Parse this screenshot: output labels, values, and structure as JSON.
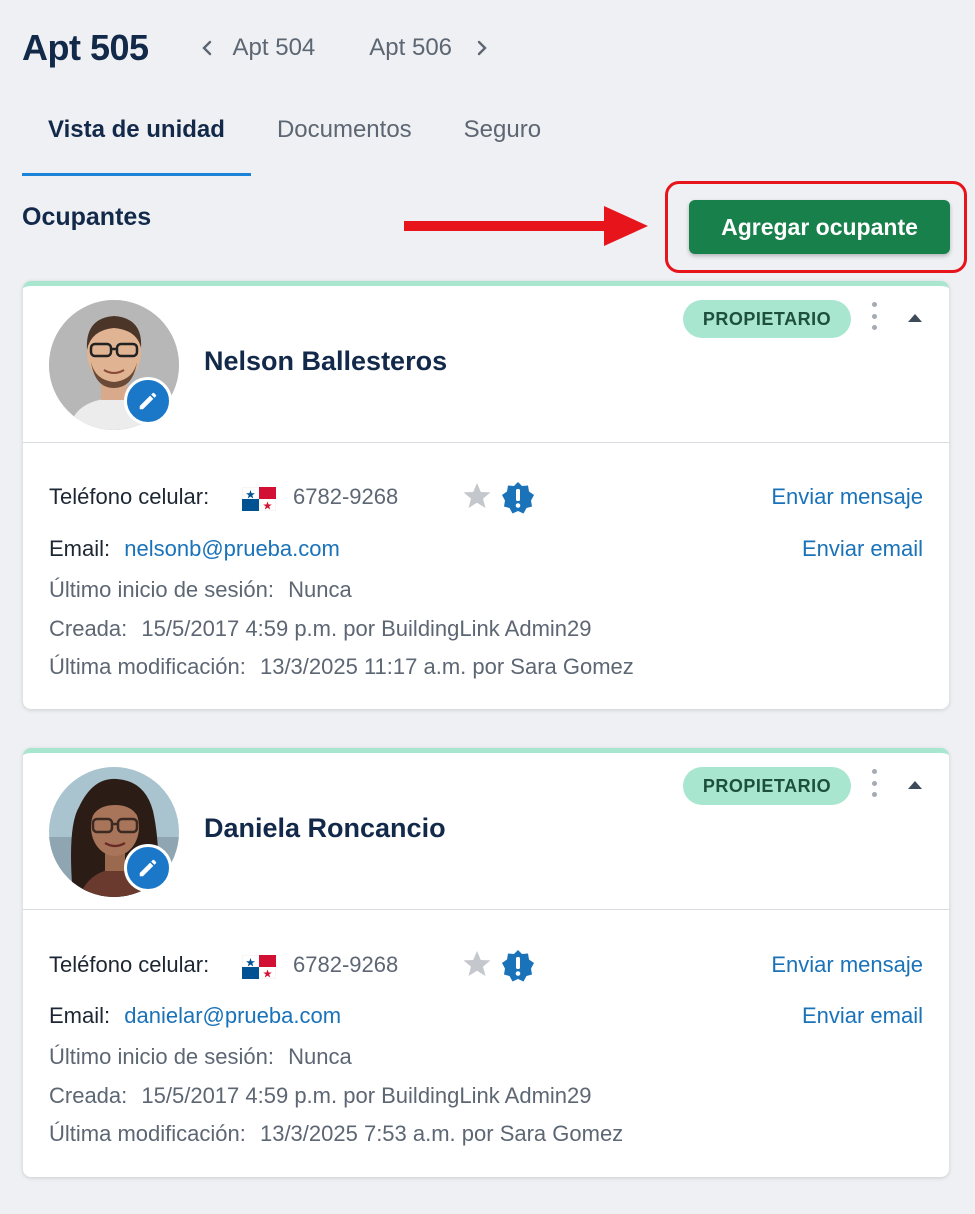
{
  "header": {
    "unit_title": "Apt 505",
    "prev_unit": "Apt 504",
    "next_unit": "Apt 506"
  },
  "tabs": [
    {
      "label": "Vista de unidad",
      "active": true
    },
    {
      "label": "Documentos",
      "active": false
    },
    {
      "label": "Seguro",
      "active": false
    }
  ],
  "section": {
    "title": "Ocupantes",
    "add_button_label": "Agregar ocupante"
  },
  "labels": {
    "phone": "Teléfono celular:",
    "email": "Email:",
    "last_login": "Último inicio de sesión:",
    "created": "Creada:",
    "modified": "Última modificación:",
    "send_message": "Enviar mensaje",
    "send_email": "Enviar email"
  },
  "occupants": [
    {
      "name": "Nelson Ballesteros",
      "role": "PROPIETARIO",
      "phone": "6782-9268",
      "email": "nelsonb@prueba.com",
      "last_login": "Nunca",
      "created": "15/5/2017 4:59 p.m. por BuildingLink Admin29",
      "modified": "13/3/2025 11:17 a.m. por Sara Gomez"
    },
    {
      "name": "Daniela Roncancio",
      "role": "PROPIETARIO",
      "phone": "6782-9268",
      "email": "danielar@prueba.com",
      "last_login": "Nunca",
      "created": "15/5/2017 4:59 p.m. por BuildingLink Admin29",
      "modified": "13/3/2025 7:53 a.m. por Sara Gomez"
    }
  ],
  "colors": {
    "primary_button": "#18804b",
    "role_badge": "#a8e6cf",
    "link": "#1a72b9",
    "highlight": "#e8141c",
    "tab_underline": "#1b84d8"
  },
  "icons": {
    "prev": "chevron-left-icon",
    "next": "chevron-right-icon",
    "edit": "pencil-icon",
    "menu": "kebab-menu-icon",
    "collapse": "caret-up-icon",
    "flag": "panama-flag-icon",
    "favorite": "star-icon",
    "alert": "alert-badge-icon"
  }
}
